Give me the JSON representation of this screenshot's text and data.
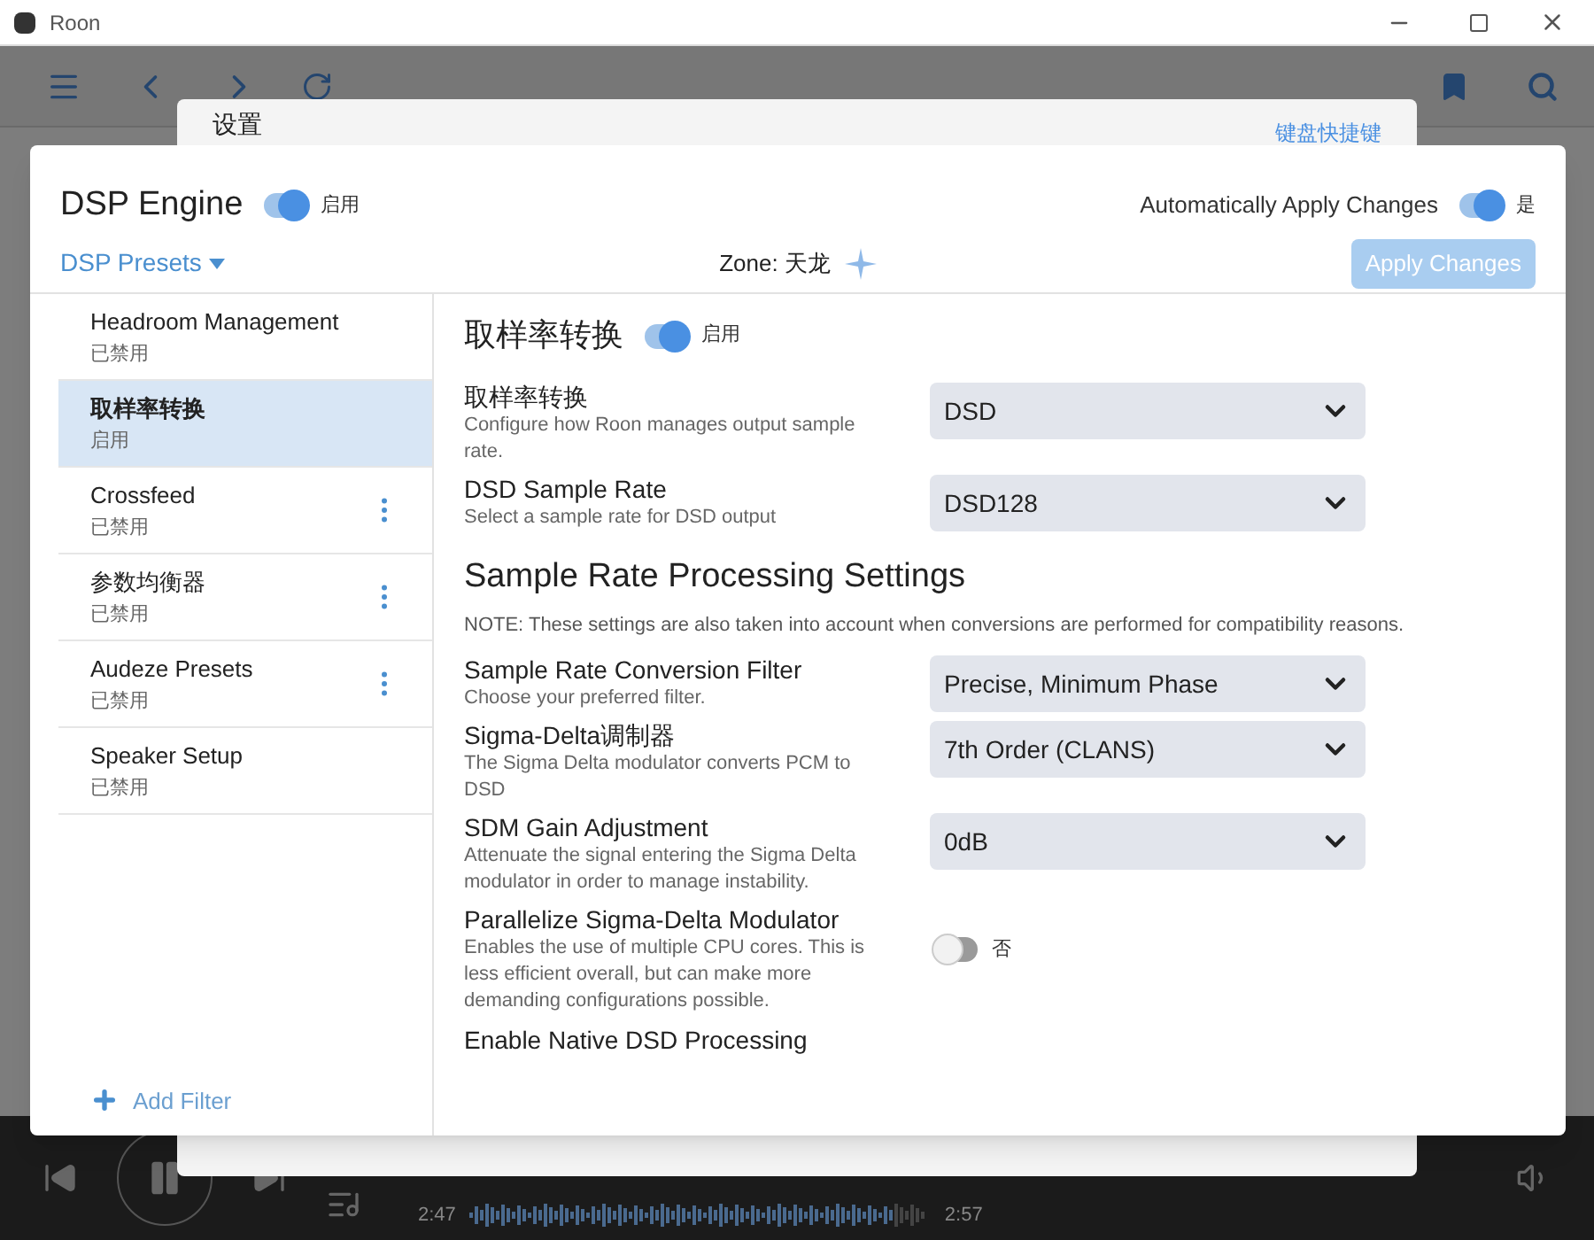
{
  "window": {
    "title": "Roon"
  },
  "settings_dialog": {
    "title": "设置",
    "link": "键盘快捷键"
  },
  "dsp": {
    "title": "DSP Engine",
    "enabled": {
      "on": true,
      "label": "启用"
    },
    "auto_apply": {
      "label": "Automatically Apply Changes",
      "on": true,
      "state_label": "是"
    },
    "presets": "DSP Presets",
    "zone": "Zone: 天龙",
    "apply_button": {
      "label": "Apply Changes",
      "disabled": true
    },
    "filters": [
      {
        "name": "Headroom Management",
        "status": "已禁用",
        "selected": false,
        "menu": false
      },
      {
        "name": "取样率转换",
        "status": "启用",
        "selected": true,
        "menu": false
      },
      {
        "name": "Crossfeed",
        "status": "已禁用",
        "selected": false,
        "menu": true
      },
      {
        "name": "参数均衡器",
        "status": "已禁用",
        "selected": false,
        "menu": true
      },
      {
        "name": "Audeze Presets",
        "status": "已禁用",
        "selected": false,
        "menu": true
      },
      {
        "name": "Speaker Setup",
        "status": "已禁用",
        "selected": false,
        "menu": false
      }
    ],
    "add_filter": "Add Filter",
    "section": {
      "title": "取样率转换",
      "on": true,
      "state_label": "启用"
    },
    "settings": [
      {
        "kind": "select",
        "label": "取样率转换",
        "description": "Configure how Roon manages output sample rate.",
        "value": "DSD"
      },
      {
        "kind": "select",
        "label": "DSD Sample Rate",
        "description": "Select a sample rate for DSD output",
        "value": "DSD128"
      },
      {
        "kind": "heading",
        "label": "Sample Rate Processing Settings"
      },
      {
        "kind": "note",
        "label": "NOTE: These settings are also taken into account when conversions are performed for compatibility reasons."
      },
      {
        "kind": "select",
        "label": "Sample Rate Conversion Filter",
        "description": "Choose your preferred filter.",
        "value": "Precise, Minimum Phase"
      },
      {
        "kind": "select",
        "label": "Sigma-Delta调制器",
        "description": "The Sigma Delta modulator converts PCM to DSD",
        "value": "7th Order (CLANS)"
      },
      {
        "kind": "select",
        "label": "SDM Gain Adjustment",
        "description": "Attenuate the signal entering the Sigma Delta modulator in order to manage instability.",
        "value": "0dB"
      },
      {
        "kind": "toggle",
        "label": "Parallelize Sigma-Delta Modulator",
        "description": "Enables the use of multiple CPU cores. This is less efficient overall, but can make more demanding configurations possible.",
        "on": false,
        "state_label": "否"
      },
      {
        "kind": "label",
        "label": "Enable Native DSD Processing"
      }
    ]
  },
  "player": {
    "elapsed": "2:47",
    "total": "2:57"
  }
}
